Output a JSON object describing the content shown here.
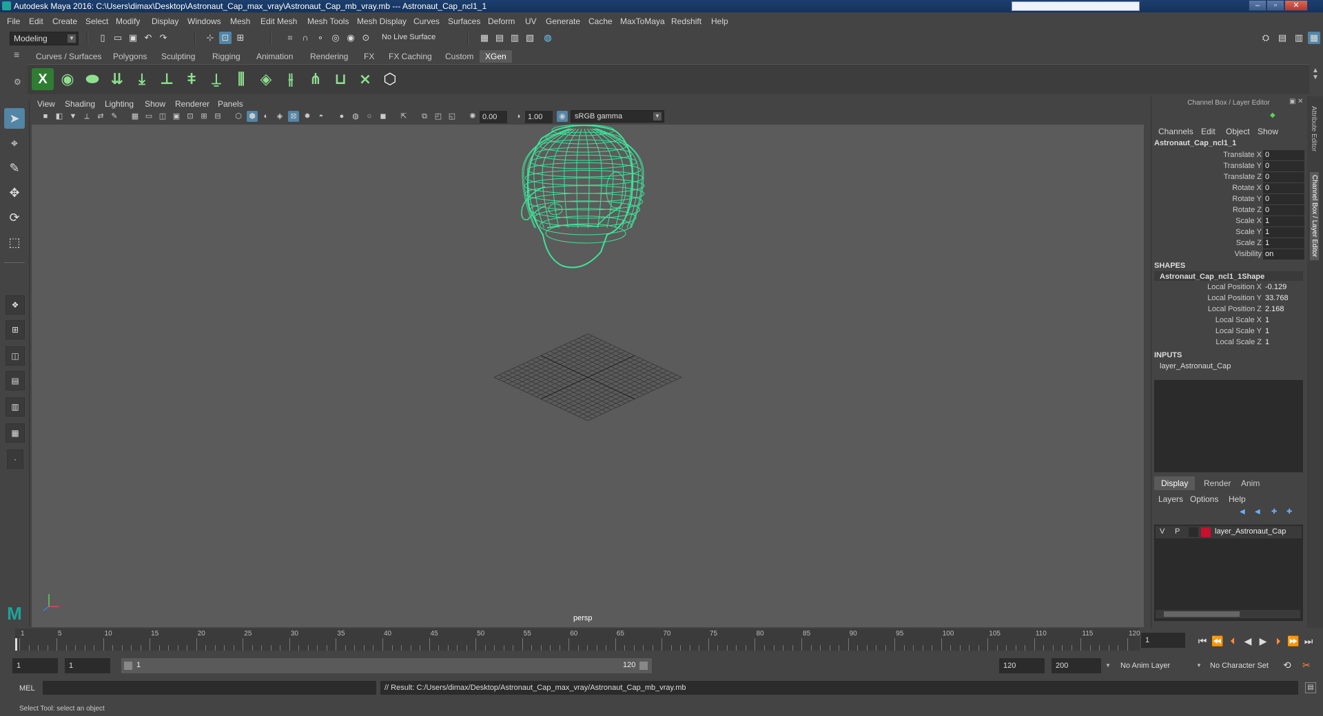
{
  "titlebar": {
    "title": "Autodesk Maya 2016: C:\\Users\\dimax\\Desktop\\Astronaut_Cap_max_vray\\Astronaut_Cap_mb_vray.mb  ---  Astronaut_Cap_ncl1_1"
  },
  "menus": [
    "File",
    "Edit",
    "Create",
    "Select",
    "Modify",
    "Display",
    "Windows",
    "Mesh",
    "Edit Mesh",
    "Mesh Tools",
    "Mesh Display",
    "Curves",
    "Surfaces",
    "Deform",
    "UV",
    "Generate",
    "Cache",
    "MaxToMaya",
    "Redshift",
    "Help"
  ],
  "toolbar": {
    "mode": "Modeling",
    "live_surface": "No Live Surface"
  },
  "shelf_tabs": [
    "Curves / Surfaces",
    "Polygons",
    "Sculpting",
    "Rigging",
    "Animation",
    "Rendering",
    "FX",
    "FX Caching",
    "Custom",
    "XGen"
  ],
  "shelf_active": "XGen",
  "viewport": {
    "menus": [
      "View",
      "Shading",
      "Lighting",
      "Show",
      "Renderer",
      "Panels"
    ],
    "exposure": "0.00",
    "gamma": "1.00",
    "colorspace": "sRGB gamma",
    "camera": "persp",
    "wire_color": "#3fe39a"
  },
  "channelbox": {
    "title": "Channel Box / Layer Editor",
    "menus": [
      "Channels",
      "Edit",
      "Object",
      "Show"
    ],
    "object": "Astronaut_Cap_ncl1_1",
    "attrs": [
      {
        "label": "Translate X",
        "value": "0"
      },
      {
        "label": "Translate Y",
        "value": "0"
      },
      {
        "label": "Translate Z",
        "value": "0"
      },
      {
        "label": "Rotate X",
        "value": "0"
      },
      {
        "label": "Rotate Y",
        "value": "0"
      },
      {
        "label": "Rotate Z",
        "value": "0"
      },
      {
        "label": "Scale X",
        "value": "1"
      },
      {
        "label": "Scale Y",
        "value": "1"
      },
      {
        "label": "Scale Z",
        "value": "1"
      },
      {
        "label": "Visibility",
        "value": "on"
      }
    ],
    "shapes_header": "SHAPES",
    "shape_name": "Astronaut_Cap_ncl1_1Shape",
    "shape_attrs": [
      {
        "label": "Local Position X",
        "value": "-0.129"
      },
      {
        "label": "Local Position Y",
        "value": "33.768"
      },
      {
        "label": "Local Position Z",
        "value": "2.168"
      },
      {
        "label": "Local Scale X",
        "value": "1"
      },
      {
        "label": "Local Scale Y",
        "value": "1"
      },
      {
        "label": "Local Scale Z",
        "value": "1"
      }
    ],
    "inputs_header": "INPUTS",
    "input_name": "layer_Astronaut_Cap"
  },
  "layers": {
    "tabs": [
      "Display",
      "Render",
      "Anim"
    ],
    "menus": [
      "Layers",
      "Options",
      "Help"
    ],
    "row": {
      "v": "V",
      "p": "P",
      "name": "layer_Astronaut_Cap",
      "color": "#c8102e"
    }
  },
  "side_tabs": [
    "Attribute Editor",
    "Channel Box / Layer Editor"
  ],
  "timeline": {
    "ticks": [
      "1",
      "5",
      "10",
      "15",
      "20",
      "25",
      "30",
      "35",
      "40",
      "45",
      "50",
      "55",
      "60",
      "65",
      "70",
      "75",
      "80",
      "85",
      "90",
      "95",
      "100",
      "105",
      "110",
      "115",
      "120"
    ],
    "current_frame": "1"
  },
  "range": {
    "start": "1",
    "start_inner": "1",
    "slider_start": "1",
    "slider_end": "120",
    "end": "120",
    "end_outer": "200",
    "anim_layer": "No Anim Layer",
    "char_set": "No Character Set"
  },
  "cmd": {
    "label": "MEL",
    "result": "// Result: C:/Users/dimax/Desktop/Astronaut_Cap_max_vray/Astronaut_Cap_mb_vray.mb"
  },
  "status": "Select Tool: select an object"
}
